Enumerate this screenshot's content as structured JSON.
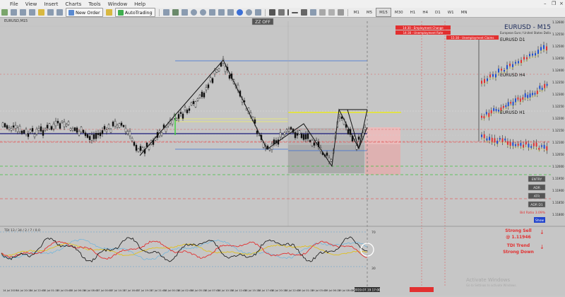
{
  "menu": [
    "File",
    "View",
    "Insert",
    "Charts",
    "Tools",
    "Window",
    "Help"
  ],
  "toolbar": {
    "new_order": "New Order",
    "autotrading": "AutoTrading",
    "timeframes": [
      "M1",
      "M5",
      "M15",
      "M30",
      "H1",
      "H4",
      "D1",
      "W1",
      "MN"
    ],
    "active_tf": "M15"
  },
  "chart": {
    "window_label": "EURUSD,M15",
    "zz_button": "ZZ OFF",
    "symbol_title": "EURUSD - M15",
    "symbol_subtitle": "European Euro / United States Dollar",
    "news": [
      "14:30 - Employment Change",
      "14:30 - Unemployment Rate",
      "15:30 - Unemployment Claims"
    ],
    "mini_charts": [
      "EURUSD D1",
      "EURUSD H4",
      "EURUSD H1"
    ],
    "buttons": [
      "ENTRY",
      "ADR",
      "ATR",
      "ADR D1"
    ],
    "risk_label": "Bid Ratio 3.09%",
    "show_button": "Show",
    "signal_line1": "Strong Sell",
    "signal_line2": "@ 1.11946",
    "trend_line1": "TDI Trend",
    "trend_line2": "Strong Down",
    "watermark": "Activate Windows",
    "watermark_sub": "Go to Settings to activate Windows.",
    "price_labels": [
      "1.12600",
      "1.12550",
      "1.12500",
      "1.12450",
      "1.12400",
      "1.12350",
      "1.12300",
      "1.12250",
      "1.12200",
      "1.12150",
      "1.12100",
      "1.12050",
      "1.12000",
      "1.11950",
      "1.11900",
      "1.11850",
      "1.11800"
    ],
    "time_labels": [
      "14 Jul 2019",
      "14 Jul 20:15",
      "14 Jul 22:45",
      "15 Jul 01:15",
      "15 Jul 03:45",
      "15 Jul 06:15",
      "16 Jul 08:45",
      "17 Jul 00:00",
      "17 Jul 14:15",
      "17 Jul 16:45",
      "17 Jul 19:15",
      "17 Jul 21:45",
      "18 Jul 00:15",
      "18 Jul 02:45",
      "18 Jul 05:15",
      "18 Jul 07:45",
      "18 Jul 10:15",
      "18 Jul 12:45",
      "18 Jul 15:15",
      "18 Jul 17:45",
      "18 Jul 20:15",
      "18 Jul 22:45",
      "19 Jul 01:15",
      "19 Jul 03:45",
      "19 Jul 06:15",
      "19 Jul 08:45",
      "19 Jul 11:15"
    ],
    "cursor_time": "2019.07.19 17:00",
    "indicator_label": "TDI 13 / 34 / 2 / 7 / 0.0",
    "level_70": "70",
    "level_30": "30"
  },
  "colors": {
    "bg": "#c6c6c6",
    "yellow": "#f0f000",
    "red": "#e23030",
    "blue_line": "#3b6fd6",
    "navy": "#1a1a7a",
    "green": "#40c040"
  }
}
